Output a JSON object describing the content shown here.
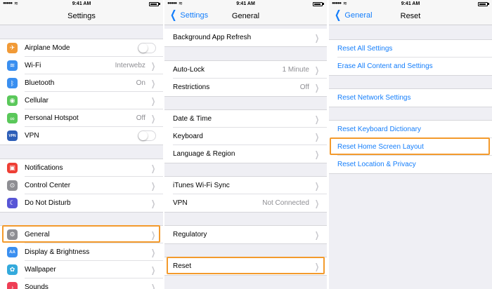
{
  "status": {
    "time": "9:41 AM",
    "signal": "●●●●●",
    "wifi": "≋"
  },
  "screens": {
    "settings": {
      "title": "Settings",
      "groups": [
        [
          {
            "label": "Airplane Mode",
            "icon": "airplane-icon",
            "glyph": "✈",
            "color": "#f19a37",
            "control": "toggle"
          },
          {
            "label": "Wi-Fi",
            "icon": "wifi-icon",
            "glyph": "≋",
            "color": "#3a8ff0",
            "value": "Interwebz"
          },
          {
            "label": "Bluetooth",
            "icon": "bluetooth-icon",
            "glyph": "ᛒ",
            "color": "#3a8ff0",
            "value": "On"
          },
          {
            "label": "Cellular",
            "icon": "cellular-icon",
            "glyph": "◉",
            "color": "#5ac85a",
            "value": ""
          },
          {
            "label": "Personal Hotspot",
            "icon": "hotspot-icon",
            "glyph": "∞",
            "color": "#5ac85a",
            "value": "Off"
          },
          {
            "label": "VPN",
            "icon": "vpn-icon",
            "glyph": "VPN",
            "color": "#2e5fb8",
            "control": "toggle"
          }
        ],
        [
          {
            "label": "Notifications",
            "icon": "notifications-icon",
            "glyph": "▣",
            "color": "#ee3f35",
            "value": ""
          },
          {
            "label": "Control Center",
            "icon": "control-center-icon",
            "glyph": "⊙",
            "color": "#8e8e93",
            "value": ""
          },
          {
            "label": "Do Not Disturb",
            "icon": "moon-icon",
            "glyph": "☾",
            "color": "#5856d6",
            "value": ""
          }
        ],
        [
          {
            "label": "General",
            "icon": "gear-icon",
            "glyph": "⚙",
            "color": "#8e8e93",
            "value": ""
          },
          {
            "label": "Display & Brightness",
            "icon": "display-icon",
            "glyph": "AA",
            "color": "#3a8ff0",
            "value": ""
          },
          {
            "label": "Wallpaper",
            "icon": "wallpaper-icon",
            "glyph": "✿",
            "color": "#34aadc",
            "value": ""
          },
          {
            "label": "Sounds",
            "icon": "sounds-icon",
            "glyph": "♪",
            "color": "#ee3f55",
            "value": ""
          }
        ]
      ]
    },
    "general": {
      "back": "Settings",
      "title": "General",
      "groups": [
        [
          {
            "label": "Background App Refresh",
            "value": ""
          }
        ],
        [
          {
            "label": "Auto-Lock",
            "value": "1 Minute"
          },
          {
            "label": "Restrictions",
            "value": "Off"
          }
        ],
        [
          {
            "label": "Date & Time",
            "value": ""
          },
          {
            "label": "Keyboard",
            "value": ""
          },
          {
            "label": "Language & Region",
            "value": ""
          }
        ],
        [
          {
            "label": "iTunes Wi-Fi Sync",
            "value": ""
          },
          {
            "label": "VPN",
            "value": "Not Connected"
          }
        ],
        [
          {
            "label": "Regulatory",
            "value": ""
          }
        ],
        [
          {
            "label": "Reset",
            "value": ""
          }
        ]
      ]
    },
    "reset": {
      "back": "General",
      "title": "Reset",
      "groups": [
        [
          {
            "label": "Reset All Settings"
          },
          {
            "label": "Erase All Content and Settings"
          }
        ],
        [
          {
            "label": "Reset Network Settings"
          }
        ],
        [
          {
            "label": "Reset Keyboard Dictionary"
          },
          {
            "label": "Reset Home Screen Layout"
          },
          {
            "label": "Reset Location & Privacy"
          }
        ]
      ]
    }
  },
  "colors": {
    "accent": "#147efb",
    "highlight": "#f39a2c"
  }
}
